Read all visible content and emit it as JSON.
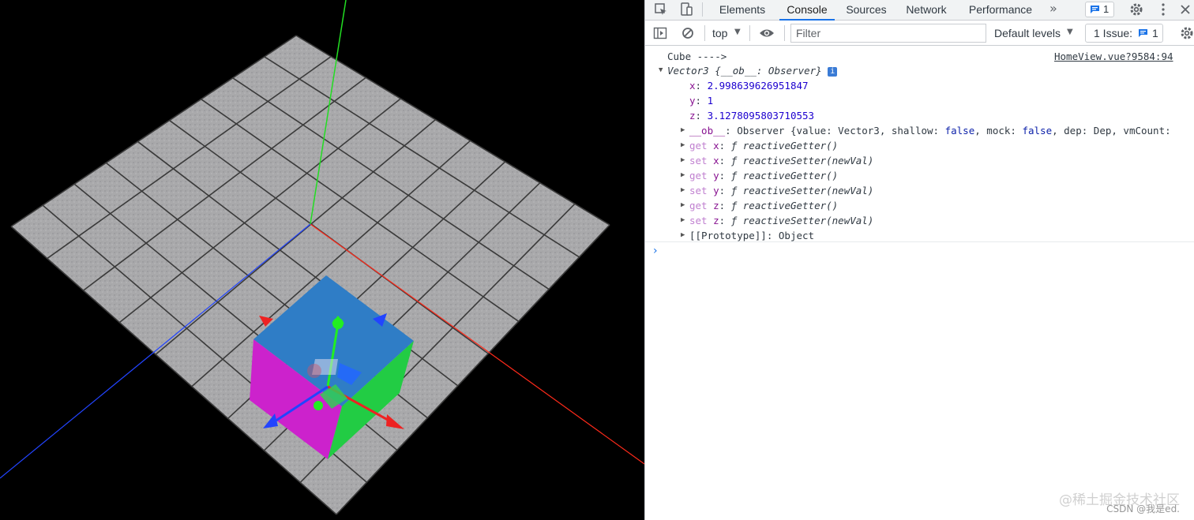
{
  "devtools": {
    "tabs": [
      "Elements",
      "Console",
      "Sources",
      "Network",
      "Performance"
    ],
    "active_tab": "Console",
    "overflow": "»",
    "message_count": "1",
    "toolbar": {
      "context": "top",
      "filter_placeholder": "Filter",
      "levels": "Default levels",
      "issues_label": "1 Issue:",
      "issues_count": "1"
    }
  },
  "console": {
    "log_label": "Cube ---->",
    "source_link": "HomeView.vue?9584:94",
    "object_header": "Vector3 {__ob__: Observer}",
    "info_badge": "i",
    "x": {
      "key": "x",
      "value": "2.998639626951847"
    },
    "y": {
      "key": "y",
      "value": "1"
    },
    "z": {
      "key": "z",
      "value": "3.1278095803710553"
    },
    "ob_line": {
      "key": "__ob__",
      "pre": ": Observer {value: Vector3, shallow: ",
      "v1": "false",
      "mid": ", mock: ",
      "v2": "false",
      "post": ", dep: Dep, vmCount:"
    },
    "accessors": [
      {
        "kind": "get",
        "prop": "x",
        "fn": "reactiveGetter()"
      },
      {
        "kind": "set",
        "prop": "x",
        "fn": "reactiveSetter(newVal)"
      },
      {
        "kind": "get",
        "prop": "y",
        "fn": "reactiveGetter()"
      },
      {
        "kind": "set",
        "prop": "y",
        "fn": "reactiveSetter(newVal)"
      },
      {
        "kind": "get",
        "prop": "z",
        "fn": "reactiveGetter()"
      },
      {
        "kind": "set",
        "prop": "z",
        "fn": "reactiveSetter(newVal)"
      }
    ],
    "prototype": "[[Prototype]]",
    "prototype_value": ": Object",
    "prompt": "›"
  },
  "watermark": {
    "line1": "@稀土掘金技术社区",
    "line2": "CSDN @我是ed."
  },
  "colors": {
    "accent": "#1a73e8",
    "x_axis": "#ff2a1a",
    "y_axis": "#22dd22",
    "z_axis": "#2244ff"
  }
}
